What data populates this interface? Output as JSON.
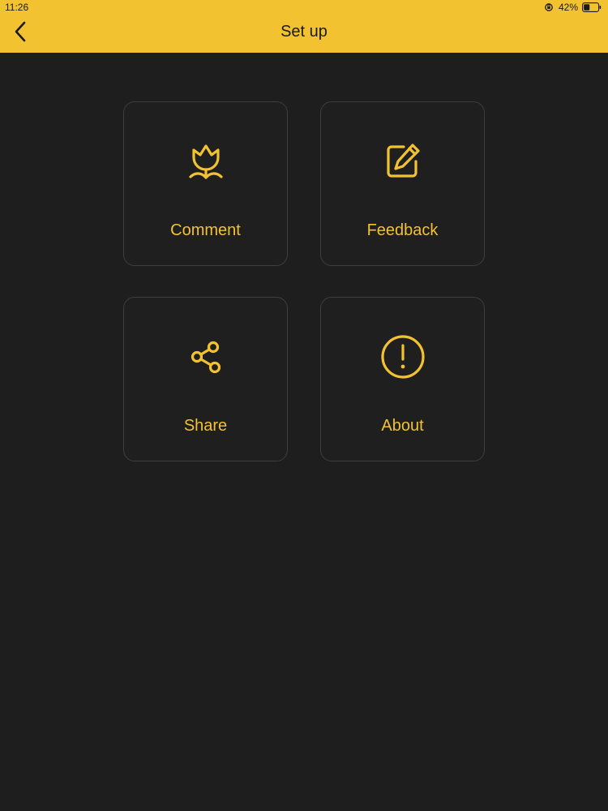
{
  "status_bar": {
    "time": "11:26",
    "battery": "42%",
    "battery_level": 0.42
  },
  "nav": {
    "title": "Set up",
    "back_icon": "chevron-left-icon"
  },
  "tiles": [
    {
      "label": "Comment",
      "icon": "tulip-icon"
    },
    {
      "label": "Feedback",
      "icon": "edit-square-icon"
    },
    {
      "label": "Share",
      "icon": "share-icon"
    },
    {
      "label": "About",
      "icon": "info-circle-icon"
    }
  ],
  "colors": {
    "accent": "#f2c230",
    "background": "#1e1e1e",
    "tile_border": "#3e3e3e",
    "header_text": "#1a1a1a"
  }
}
